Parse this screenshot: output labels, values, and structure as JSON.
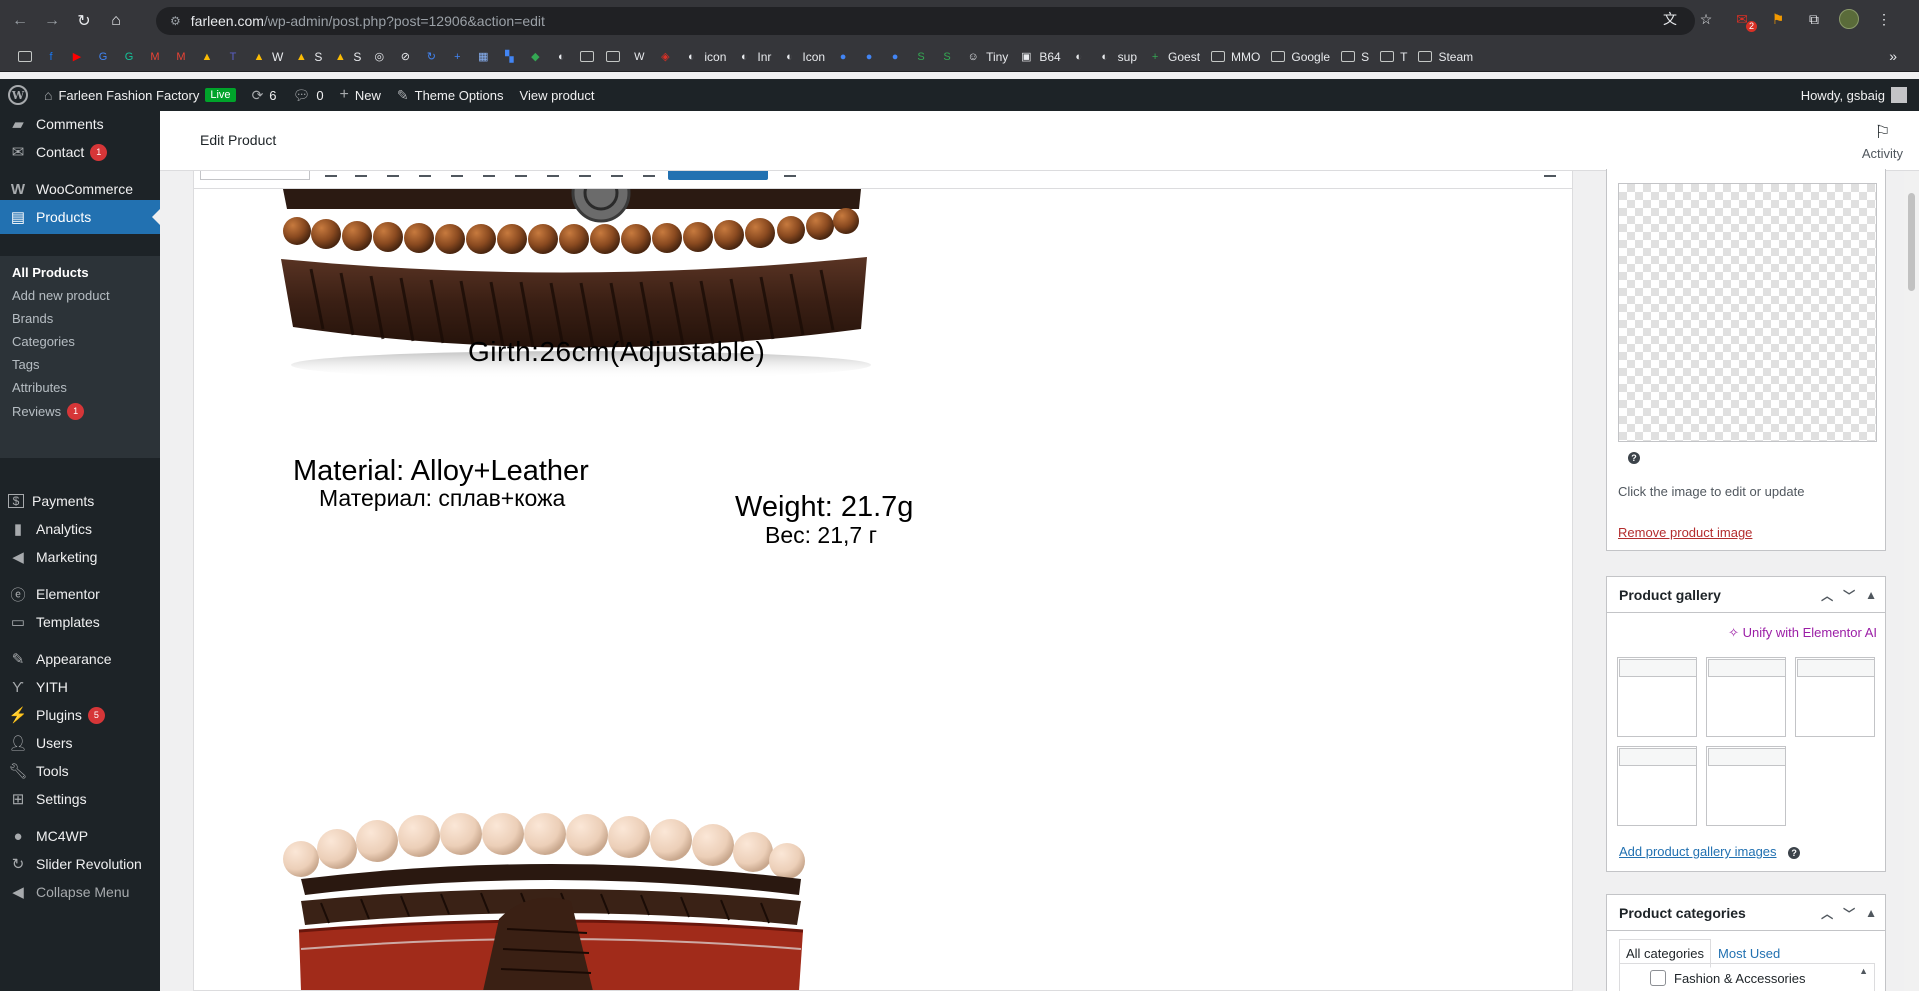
{
  "browser": {
    "url_domain": "farleen.com",
    "url_path": "/wp-admin/post.php?post=12906&action=edit",
    "extension_badge": "2",
    "bookmarks": [
      {
        "icon": "folder-icon",
        "label": ""
      },
      {
        "icon": "facebook-icon",
        "label": "",
        "color": "#1877f2",
        "glyph": "f"
      },
      {
        "icon": "youtube-icon",
        "label": "",
        "color": "#ff0000",
        "glyph": "▶"
      },
      {
        "icon": "translate-icon",
        "label": "",
        "color": "#4285f4",
        "glyph": "G"
      },
      {
        "icon": "grammarly-icon",
        "label": "",
        "color": "#15c39a",
        "glyph": "G"
      },
      {
        "icon": "gmail-icon",
        "label": "",
        "color": "#ea4335",
        "glyph": "M"
      },
      {
        "icon": "gmail-icon",
        "label": "",
        "color": "#ea4335",
        "glyph": "M"
      },
      {
        "icon": "drive-icon",
        "label": "",
        "color": "#fbbc04",
        "glyph": "▲"
      },
      {
        "icon": "teams-icon",
        "label": "",
        "color": "#5b5fc7",
        "glyph": "T"
      },
      {
        "icon": "drive-icon",
        "label": "W",
        "color": "#fbbc04",
        "glyph": "▲"
      },
      {
        "icon": "drive-icon",
        "label": "S",
        "color": "#fbbc04",
        "glyph": "▲"
      },
      {
        "icon": "drive-icon",
        "label": "S",
        "color": "#fbbc04",
        "glyph": "▲"
      },
      {
        "icon": "target-icon",
        "label": "",
        "color": "#e8eaed",
        "glyph": "◎"
      },
      {
        "icon": "ban-icon",
        "label": "",
        "color": "#e8eaed",
        "glyph": "⊘"
      },
      {
        "icon": "sync-icon",
        "label": "",
        "color": "#4285f4",
        "glyph": "↻"
      },
      {
        "icon": "plus-circle-icon",
        "label": "",
        "color": "#4285f4",
        "glyph": "+"
      },
      {
        "icon": "grid-icon",
        "label": "",
        "color": "#8ab4f8",
        "glyph": "▦"
      },
      {
        "icon": "apps-icon",
        "label": "",
        "color": "#4285f4",
        "glyph": "▚"
      },
      {
        "icon": "maps-icon",
        "label": "",
        "color": "#34a853",
        "glyph": "◆"
      },
      {
        "icon": "globe-icon",
        "label": "",
        "color": "#e8eaed",
        "glyph": "◐"
      },
      {
        "icon": "folder-icon",
        "label": ""
      },
      {
        "icon": "folder-icon",
        "label": ""
      },
      {
        "icon": "wordpress-icon",
        "label": "",
        "color": "#e8eaed",
        "glyph": "W"
      },
      {
        "icon": "shield-icon",
        "label": "",
        "color": "#d93025",
        "glyph": "◈"
      },
      {
        "icon": "globe-icon",
        "label": "icon",
        "color": "#e8eaed",
        "glyph": "◐"
      },
      {
        "icon": "globe-icon",
        "label": "Inr",
        "color": "#e8eaed",
        "glyph": "◐"
      },
      {
        "icon": "globe-icon",
        "label": "Icon",
        "color": "#e8eaed",
        "glyph": "◐"
      },
      {
        "icon": "toggle-icon",
        "label": "",
        "color": "#4285f4",
        "glyph": "●"
      },
      {
        "icon": "toggle-icon",
        "label": "",
        "color": "#4285f4",
        "glyph": "●"
      },
      {
        "icon": "toggle-icon",
        "label": "",
        "color": "#4285f4",
        "glyph": "●"
      },
      {
        "icon": "shopify-icon",
        "label": "",
        "color": "#34a853",
        "glyph": "S"
      },
      {
        "icon": "shopify-icon",
        "label": "",
        "color": "#34a853",
        "glyph": "S"
      },
      {
        "icon": "tiny-icon",
        "label": "Tiny",
        "color": "#e8eaed",
        "glyph": "☺"
      },
      {
        "icon": "image-icon",
        "label": "B64",
        "color": "#e8eaed",
        "glyph": "▣"
      },
      {
        "icon": "globe-icon",
        "label": "",
        "color": "#e8eaed",
        "glyph": "◐"
      },
      {
        "icon": "globe-icon",
        "label": "sup",
        "color": "#e8eaed",
        "glyph": "◐"
      },
      {
        "icon": "sheets-icon",
        "label": "Goest",
        "color": "#34a853",
        "glyph": "+"
      },
      {
        "icon": "folder-icon",
        "label": "MMO"
      },
      {
        "icon": "folder-icon",
        "label": "Google"
      },
      {
        "icon": "folder-icon",
        "label": "S"
      },
      {
        "icon": "folder-icon",
        "label": "T"
      },
      {
        "icon": "folder-icon",
        "label": "Steam"
      }
    ]
  },
  "adminbar": {
    "site_name": "Farleen Fashion Factory",
    "live_label": "Live",
    "updates_count": "6",
    "comments_count": "0",
    "new_label": "New",
    "theme_options_label": "Theme Options",
    "view_product_label": "View product",
    "howdy": "Howdy, gsbaig"
  },
  "menu": {
    "comments": "Comments",
    "contact": "Contact",
    "contact_count": "1",
    "woocommerce": "WooCommerce",
    "products": "Products",
    "sub": {
      "all_products": "All Products",
      "add_new": "Add new product",
      "brands": "Brands",
      "categories": "Categories",
      "tags": "Tags",
      "attributes": "Attributes",
      "reviews": "Reviews",
      "reviews_count": "1"
    },
    "payments": "Payments",
    "analytics": "Analytics",
    "marketing": "Marketing",
    "elementor": "Elementor",
    "templates": "Templates",
    "appearance": "Appearance",
    "yith": "YITH",
    "plugins": "Plugins",
    "plugins_count": "5",
    "users": "Users",
    "tools": "Tools",
    "settings": "Settings",
    "mc4wp": "MC4WP",
    "slider_revolution": "Slider Revolution",
    "collapse": "Collapse Menu"
  },
  "header": {
    "title": "Edit Product",
    "activity": "Activity"
  },
  "editor_image": {
    "girth": "Girth:26cm(Adjustable)",
    "material_en": "Material: Alloy+Leather",
    "material_ru": "Материал: сплав+кожа",
    "weight_en": "Weight: 21.7g",
    "weight_ru": "Вес: 21,7 г"
  },
  "product_image": {
    "hint": "Click the image to edit or update",
    "remove": "Remove product image"
  },
  "gallery": {
    "title": "Product gallery",
    "unify": "Unify with Elementor AI",
    "add": "Add product gallery images",
    "thumb_count": 5
  },
  "categories": {
    "title": "Product categories",
    "tab_all": "All categories",
    "tab_most_used": "Most Used",
    "items": [
      {
        "label": "Fashion & Accessories",
        "checked": false
      }
    ]
  },
  "colors": {
    "wp_blue": "#2271b1",
    "admin_dark": "#1d2327",
    "badge_red": "#d63638",
    "live_green": "#00a32a"
  }
}
